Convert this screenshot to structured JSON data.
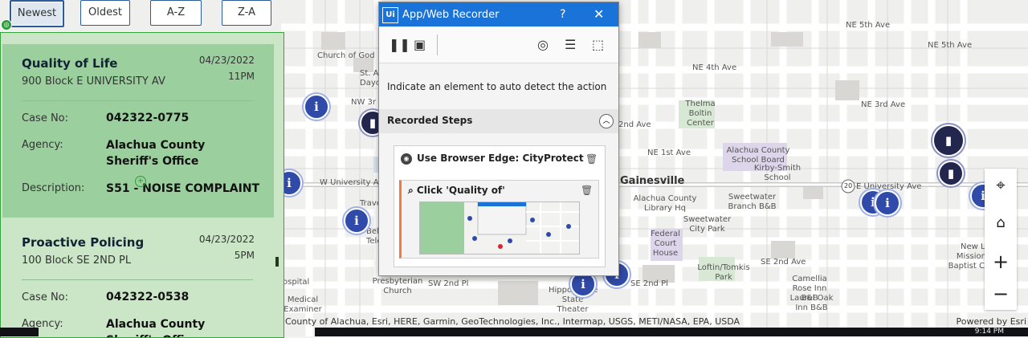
{
  "sort_buttons": [
    "Newest",
    "Oldest",
    "A-Z",
    "Z-A"
  ],
  "incidents": [
    {
      "title": "Quality of Life",
      "address": "900 Block E UNIVERSITY AV",
      "date": "04/23/2022",
      "time": "11PM",
      "case_label": "Case No:",
      "case": "042322-0775",
      "agency_label": "Agency:",
      "agency": "Alachua County Sheriff's Office",
      "desc_label": "Description:",
      "desc": "S51 - NOISE COMPLAINT"
    },
    {
      "title": "Proactive Policing",
      "address": "100 Block SE 2ND PL",
      "date": "04/23/2022",
      "time": "5PM",
      "case_label": "Case No:",
      "case": "042322-0538",
      "agency_label": "Agency:",
      "agency": "Alachua County Sheriff's Office"
    }
  ],
  "recorder": {
    "title": "App/Web Recorder",
    "logo": "Ui",
    "help": "?",
    "close": "✕",
    "hint": "Indicate an element to auto detect the action",
    "steps_heading": "Recorded Steps",
    "step": "Use Browser Edge: CityProtect",
    "substep": "Click 'Quality of'",
    "icons": [
      "pause-icon",
      "save-icon",
      "target-icon",
      "checklist-icon",
      "screen-select-icon"
    ]
  },
  "map": {
    "labels": {
      "gainesville": "Gainesville",
      "university_w": "W University Av",
      "university_e": "E University Ave",
      "ne5": "NE 5th Ave",
      "ne5b": "NE 5th Ave",
      "ne4": "NE 4th Ave",
      "ne3": "NE 3rd Ave",
      "ne2": "2nd Ave",
      "ne1": "NE 1st Ave",
      "se2": "SE 2nd Ave",
      "se2pl": "SE 2nd Pl",
      "sw2": "SW 2nd Pl",
      "nw3": "NW 3r",
      "church": "Church of God",
      "thelma": "Thelma Boltin Center",
      "school_board": "Alachua County School Board",
      "kirby": "Kirby-Smith School",
      "library": "Alachua County Library Hq",
      "sweetwater_park": "Sweetwater City Park",
      "sweetwater_bb": "Sweetwater Branch B&B",
      "federal": "Federal Court House",
      "loftin": "Loftin/Tomkis Park",
      "camellia": "Camellia Rose Inn B&B",
      "laurel": "Laurel Oak Inn B&B",
      "presbyterian": "Presbyterian Church",
      "hippodrome": "Hippodrome State Theater",
      "newlife": "New Life Missionary Baptist Church",
      "stday": "St. A Dayc",
      "travel": "Trave",
      "telecom": "Bel Telecon",
      "hospital": "ospital",
      "medical": "Medical Examiner",
      "route": "20"
    },
    "attribution": "County of Alachua, Esri, HERE, Garmin, GeoTechnologies, Inc., Intermap, USGS, METI/NASA, EPA, USDA",
    "powered": "Powered by Esri",
    "controls": [
      "locate-icon",
      "home-icon",
      "zoom-in-icon",
      "zoom-out-icon"
    ],
    "zoom_in": "+",
    "zoom_out": "−"
  },
  "clock": "9:14 PM",
  "colors": {
    "panel_bg": "#cbe6c7",
    "selected_card": "#9bcf9e",
    "recorder_title": "#1a73d9",
    "pin": "#2f4aa8"
  }
}
